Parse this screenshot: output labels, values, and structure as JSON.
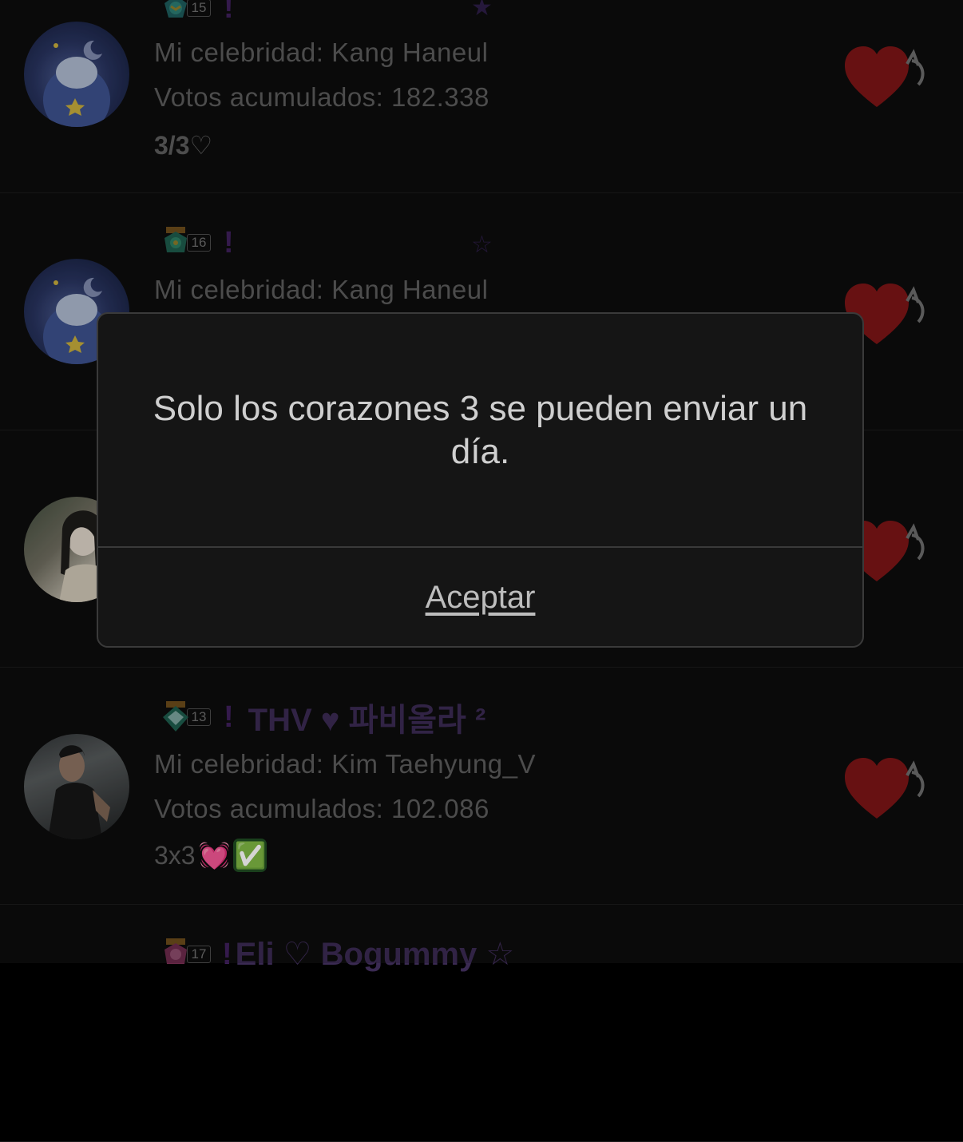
{
  "feed": {
    "items": [
      {
        "level": "15",
        "exclamation": "!",
        "username": "",
        "celebrity_line": "Mi celebridad: Kang Haneul",
        "votes_line": "Votos acumulados: 182.338",
        "note": "3/3♡",
        "avatar_icon": "bear-on-moon-avatar",
        "action_icon": "send-heart-icon"
      },
      {
        "level": "16",
        "exclamation": "!",
        "username": "",
        "celebrity_line": "Mi celebridad: Kang Haneul",
        "votes_line": "",
        "note": "",
        "avatar_icon": "bear-on-moon-avatar",
        "action_icon": "send-heart-icon"
      },
      {
        "level": "",
        "exclamation": "",
        "username": "",
        "celebrity_line": "",
        "votes_line": "",
        "note": "",
        "avatar_icon": "woman-photo-avatar",
        "action_icon": "send-heart-icon"
      },
      {
        "level": "13",
        "exclamation": "!",
        "username": "THV ♥ 파비올라 ²",
        "celebrity_line": "Mi celebridad: Kim Taehyung_V",
        "votes_line": "Votos acumulados: 102.086",
        "note": "3x3",
        "note_emojis": [
          "💓",
          "✅"
        ],
        "avatar_icon": "man-photo-avatar",
        "action_icon": "send-heart-icon"
      },
      {
        "level": "17",
        "exclamation": "!",
        "username": "Eli ♡ Bogummy ☆",
        "avatar_icon": "",
        "action_icon": ""
      }
    ]
  },
  "dialog": {
    "message": "Solo los corazones 3 se pueden enviar un día.",
    "button_label": "Aceptar"
  },
  "colors": {
    "heart": "#7a1516",
    "username": "#3a2a52",
    "text": "#5a5a5a",
    "dialog_bg": "#151515",
    "dialog_text": "#cfcfcf"
  }
}
